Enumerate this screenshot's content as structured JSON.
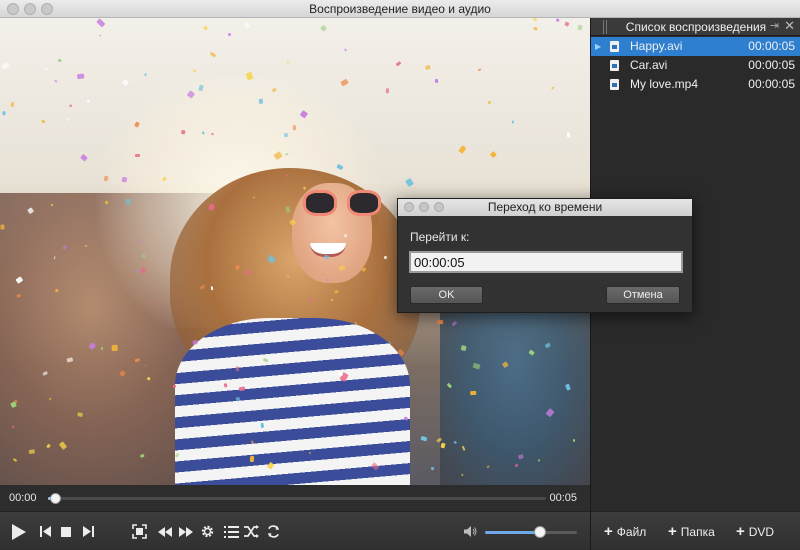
{
  "window": {
    "title": "Воспроизведение видео и аудио"
  },
  "player": {
    "current_time": "00:00",
    "duration": "00:05",
    "progress": 0.014,
    "volume": 0.6
  },
  "playlist": {
    "title": "Список воспроизведения",
    "items": [
      {
        "name": "Happy.avi",
        "duration": "00:00:05",
        "active": true
      },
      {
        "name": "Car.avi",
        "duration": "00:00:05",
        "active": false
      },
      {
        "name": "My love.mp4",
        "duration": "00:00:05",
        "active": false
      }
    ],
    "footer": {
      "add_file": "Файл",
      "add_folder": "Папка",
      "add_dvd": "DVD"
    }
  },
  "dialog": {
    "title": "Переход ко времени",
    "label": "Перейти к:",
    "value": "00:00:05",
    "ok": "OK",
    "cancel": "Отмена"
  },
  "colors": {
    "accent": "#2f7fd1",
    "progress": "#9ec7ff",
    "volume": "#6fa8e8"
  }
}
